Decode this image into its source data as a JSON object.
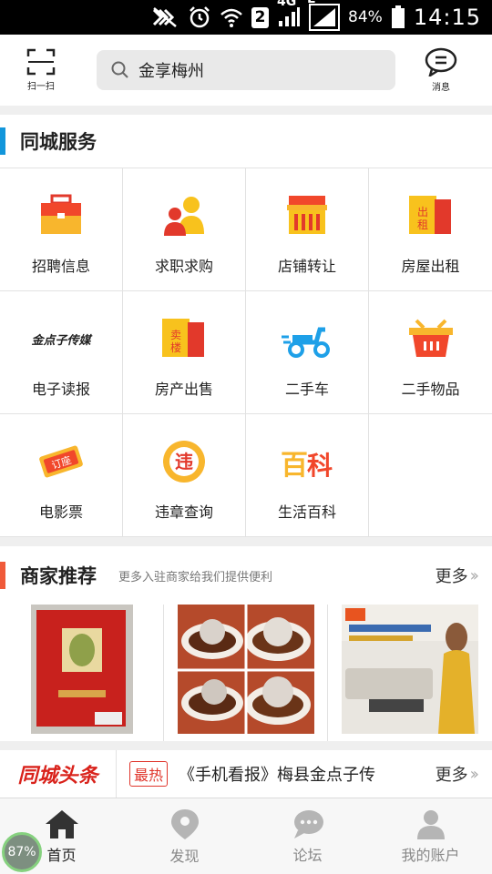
{
  "status_bar": {
    "sim_slot": "2",
    "network_4g": "4G",
    "network_e": "E",
    "battery": "84%",
    "time": "14:15"
  },
  "header": {
    "scan_label": "扫一扫",
    "search_text": "金享梅州",
    "message_label": "消息"
  },
  "city_services": {
    "title": "同城服务",
    "accent_color": "#1296db",
    "items": [
      {
        "label": "招聘信息",
        "icon": "briefcase-icon"
      },
      {
        "label": "求职求购",
        "icon": "people-icon"
      },
      {
        "label": "店铺转让",
        "icon": "shop-icon"
      },
      {
        "label": "房屋出租",
        "icon": "rent-sign-icon"
      },
      {
        "label": "电子读报",
        "icon": "newspaper-logo-icon",
        "logo_text": "金点子传媒"
      },
      {
        "label": "房产出售",
        "icon": "sale-sign-icon"
      },
      {
        "label": "二手车",
        "icon": "scooter-icon"
      },
      {
        "label": "二手物品",
        "icon": "basket-icon"
      },
      {
        "label": "电影票",
        "icon": "ticket-icon",
        "icon_text": "订座"
      },
      {
        "label": "违章查询",
        "icon": "traffic-violation-icon"
      },
      {
        "label": "生活百科",
        "icon": "encyclopedia-icon"
      }
    ]
  },
  "merchants": {
    "title": "商家推荐",
    "subtitle": "更多入驻商家给我们提供便利",
    "more": "更多",
    "accent_color": "#f05a3a",
    "images": [
      "tea-gift-box-image",
      "meatball-soup-image",
      "sofa-furniture-ad-image"
    ]
  },
  "headlines": {
    "logo": "同城头条",
    "badge": "最热",
    "headline": "《手机看报》梅县金点子传",
    "more": "更多"
  },
  "tab_bar": {
    "tabs": [
      {
        "label": "首页",
        "icon": "home-icon",
        "active": true
      },
      {
        "label": "发现",
        "icon": "location-pin-icon",
        "active": false
      },
      {
        "label": "论坛",
        "icon": "chat-bubbles-icon",
        "active": false
      },
      {
        "label": "我的账户",
        "icon": "user-icon",
        "active": false
      }
    ]
  },
  "floating_indicator": "87%"
}
